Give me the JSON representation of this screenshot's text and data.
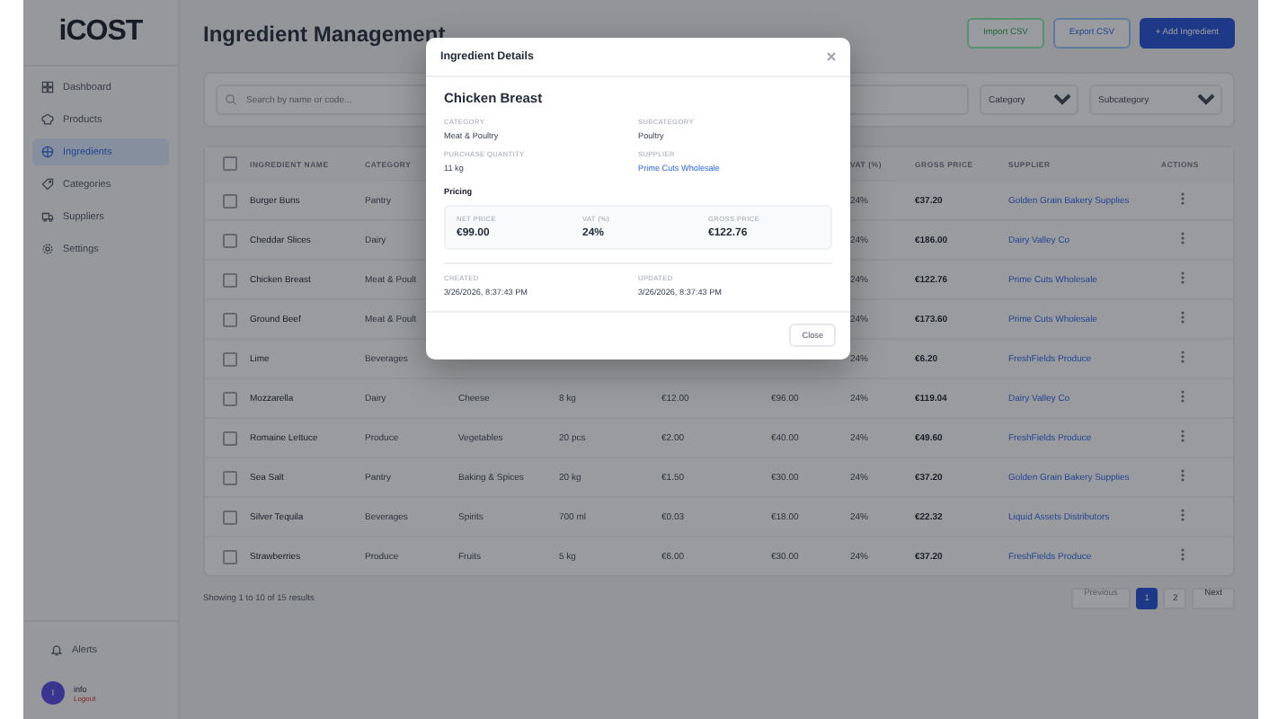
{
  "sidebar": {
    "logo": "iCOST",
    "items": [
      {
        "label": "Dashboard",
        "selected": false
      },
      {
        "label": "Products",
        "selected": false
      },
      {
        "label": "Ingredients",
        "selected": true
      },
      {
        "label": "Categories",
        "selected": false
      },
      {
        "label": "Suppliers",
        "selected": false
      },
      {
        "label": "Settings",
        "selected": false
      }
    ],
    "alerts": "Alerts",
    "user": {
      "initial": "I",
      "name": "info",
      "logout": "Logout"
    }
  },
  "header": {
    "title": "Ingredient Management",
    "buttons": [
      {
        "label": "Import CSV",
        "kind": "import"
      },
      {
        "label": "Export CSV",
        "kind": "export"
      },
      {
        "label": "+ Add Ingredient",
        "kind": "primary"
      }
    ]
  },
  "filters": {
    "search": {
      "placeholder": "Search by name or code..."
    },
    "selects": [
      "Category",
      "Subcategory"
    ]
  },
  "table": {
    "header_checked": false,
    "columns": [
      {
        "kind": "text",
        "label": "INGREDIENT NAME"
      },
      {
        "kind": "text",
        "label": "CATEGORY"
      },
      {
        "kind": "text"
      },
      {
        "kind": "text"
      },
      {
        "kind": "text"
      },
      {
        "kind": "text"
      },
      {
        "kind": "text",
        "label": "VAT (%)"
      },
      {
        "kind": "bold",
        "label": "GROSS PRICE"
      },
      {
        "kind": "link",
        "label": "SUPPLIER"
      },
      {
        "kind": "actions",
        "label": "ACTIONS"
      }
    ],
    "rows": [
      {
        "checked": false,
        "cells": [
          "Burger Buns",
          "Pantry",
          null,
          null,
          null,
          null,
          "24%",
          "€37.20",
          "Golden Grain Bakery Supplies"
        ]
      },
      {
        "checked": false,
        "cells": [
          "Cheddar Slices",
          "Dairy",
          null,
          null,
          null,
          null,
          "24%",
          "€186.00",
          "Dairy Valley Co"
        ]
      },
      {
        "checked": false,
        "cells": [
          "Chicken Breast",
          "Meat & Poult",
          null,
          null,
          null,
          null,
          "24%",
          "€122.76",
          "Prime Cuts Wholesale"
        ]
      },
      {
        "checked": false,
        "cells": [
          "Ground Beef",
          "Meat & Poult",
          null,
          null,
          null,
          null,
          "24%",
          "€173.60",
          "Prime Cuts Wholesale"
        ]
      },
      {
        "checked": false,
        "cells": [
          "Lime",
          "Beverages",
          null,
          null,
          null,
          null,
          "24%",
          "€6.20",
          "FreshFields Produce"
        ]
      },
      {
        "checked": false,
        "cells": [
          "Mozzarella",
          "Dairy",
          "Cheese",
          "8 kg",
          "€12.00",
          "€96.00",
          "24%",
          "€119.04",
          "Dairy Valley Co"
        ]
      },
      {
        "checked": false,
        "cells": [
          "Romaine Lettuce",
          "Produce",
          "Vegetables",
          "20 pcs",
          "€2.00",
          "€40.00",
          "24%",
          "€49.60",
          "FreshFields Produce"
        ]
      },
      {
        "checked": false,
        "cells": [
          "Sea Salt",
          "Pantry",
          "Baking & Spices",
          "20 kg",
          "€1.50",
          "€30.00",
          "24%",
          "€37.20",
          "Golden Grain Bakery Supplies"
        ]
      },
      {
        "checked": false,
        "cells": [
          "Silver Tequila",
          "Beverages",
          "Spirits",
          "700 ml",
          "€0.03",
          "€18.00",
          "24%",
          "€22.32",
          "Liquid Assets Distributors"
        ]
      },
      {
        "checked": false,
        "cells": [
          "Strawberries",
          "Produce",
          "Fruits",
          "5 kg",
          "€6.00",
          "€30.00",
          "24%",
          "€37.20",
          "FreshFields Produce"
        ]
      }
    ],
    "summary": "Showing 1 to 10 of 15 results",
    "pagination": [
      {
        "label": "Previous",
        "kind": "nav",
        "disabled": true,
        "selected": false
      },
      {
        "label": "1",
        "kind": "page",
        "disabled": false,
        "selected": true
      },
      {
        "label": "2",
        "kind": "page",
        "disabled": false,
        "selected": false
      },
      {
        "label": "Next",
        "kind": "nav",
        "disabled": false,
        "selected": false
      }
    ]
  },
  "modal": {
    "title": "Ingredient Details",
    "name": "Chicken Breast",
    "fields": [
      {
        "label": "CATEGORY",
        "value": "Meat & Poultry",
        "kind": "text"
      },
      {
        "label": "SUBCATEGORY",
        "value": "Poultry",
        "kind": "text"
      },
      {
        "label": "PURCHASE QUANTITY",
        "value": "11 kg",
        "kind": "text"
      },
      {
        "label": "SUPPLIER",
        "value": "Prime Cuts Wholesale",
        "kind": "link"
      }
    ],
    "pricing_title": "Pricing",
    "pricing": [
      {
        "label": "NET PRICE",
        "value": "€99.00"
      },
      {
        "label": "VAT (%)",
        "value": "24%"
      },
      {
        "label": "GROSS PRICE",
        "value": "€122.76"
      }
    ],
    "timestamps": [
      {
        "label": "CREATED",
        "value": "3/26/2026, 8:37:43 PM"
      },
      {
        "label": "UPDATED",
        "value": "3/26/2026, 8:37:43 PM"
      }
    ],
    "close_button": "Close"
  }
}
